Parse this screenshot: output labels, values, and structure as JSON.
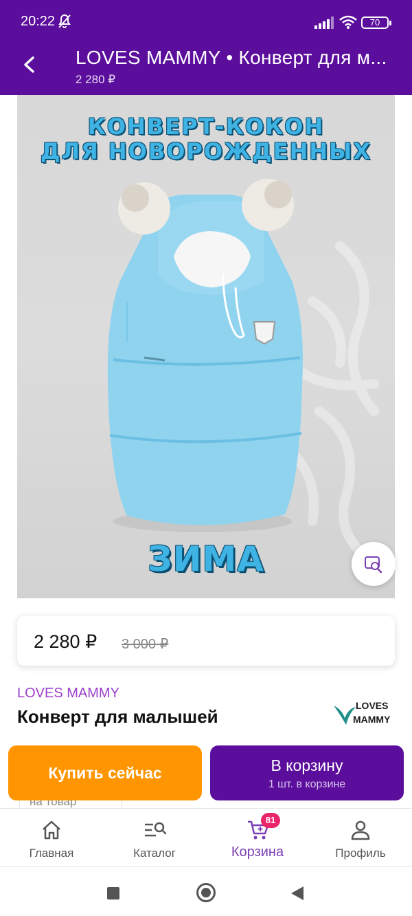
{
  "status_bar": {
    "time": "20:22",
    "battery": "70"
  },
  "app_bar": {
    "title": "LOVES MAMMY • Конверт для м...",
    "price": "2 280 ₽"
  },
  "hero": {
    "title_line1": "КОНВЕРТ-КОКОН",
    "title_line2": "ДЛЯ НОВОРОЖДЕННЫХ",
    "bottom_text": "ЗИМА"
  },
  "price_card": {
    "current": "2 280 ₽",
    "old": "3 000 ₽"
  },
  "product": {
    "brand": "LOVES MAMMY",
    "name": "Конверт для малышей",
    "logo_line1": "LOVES",
    "logo_line2": "MAMMY"
  },
  "actions": {
    "buy_now": "Купить сейчас",
    "add_to_cart": "В корзину",
    "cart_count": "1 шт. в корзине",
    "peek_text": "на товар"
  },
  "bottom_nav": {
    "items": [
      {
        "label": "Главная",
        "icon": "home-icon"
      },
      {
        "label": "Каталог",
        "icon": "catalog-search-icon"
      },
      {
        "label": "Корзина",
        "icon": "cart-icon",
        "badge": "81",
        "active": true
      },
      {
        "label": "Профиль",
        "icon": "profile-icon"
      }
    ]
  },
  "colors": {
    "brand_purple": "#5b0d9c",
    "buy_orange": "#ff9500",
    "badge_pink": "#e8256a"
  }
}
